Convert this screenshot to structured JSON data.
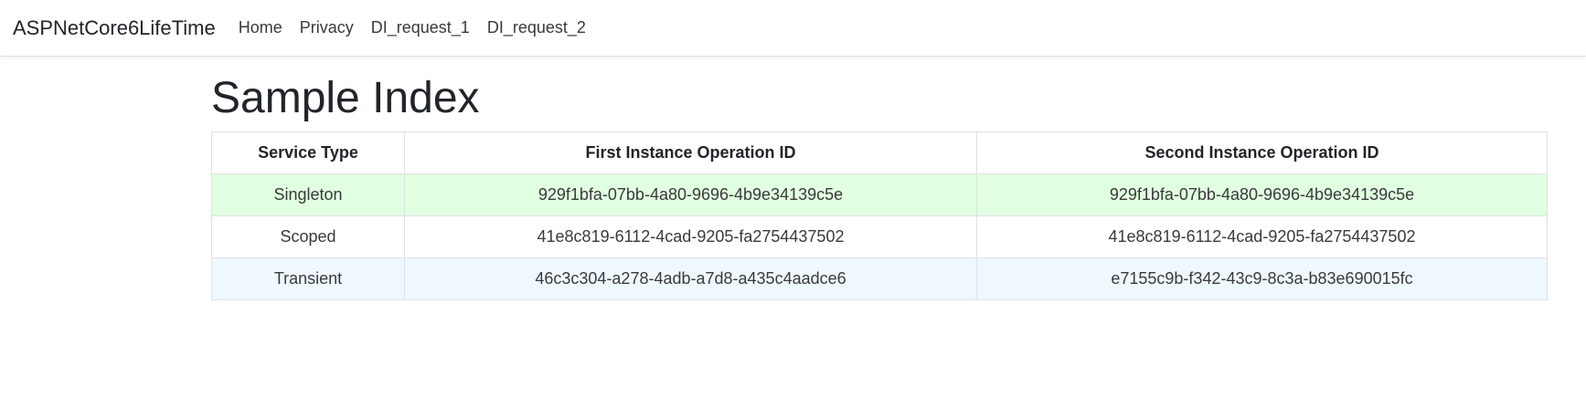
{
  "navbar": {
    "brand": "ASPNetCore6LifeTime",
    "links": [
      "Home",
      "Privacy",
      "DI_request_1",
      "DI_request_2"
    ]
  },
  "main": {
    "title": "Sample Index",
    "table": {
      "headers": [
        "Service Type",
        "First Instance Operation ID",
        "Second Instance Operation ID"
      ],
      "rows": [
        [
          "Singleton",
          "929f1bfa-07bb-4a80-9696-4b9e34139c5e",
          "929f1bfa-07bb-4a80-9696-4b9e34139c5e"
        ],
        [
          "Scoped",
          "41e8c819-6112-4cad-9205-fa2754437502",
          "41e8c819-6112-4cad-9205-fa2754437502"
        ],
        [
          "Transient",
          "46c3c304-a278-4adb-a7d8-a435c4aadce6",
          "e7155c9b-f342-43c9-8c3a-b83e690015fc"
        ]
      ],
      "row_colors": [
        "#e1ffe1",
        "#ffffff",
        "#eff7ff"
      ]
    }
  }
}
